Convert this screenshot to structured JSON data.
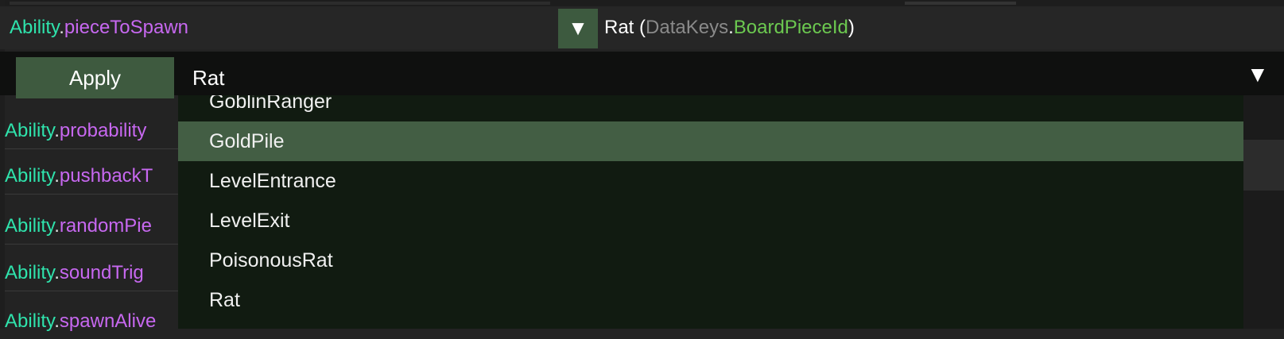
{
  "property_row": {
    "class_name": "Ability",
    "dot": ".",
    "field_name": "pieceToSpawn",
    "dropdown_toggle": "▼",
    "value": {
      "name": "Rat",
      "open_paren": " (",
      "namespace": "DataKeys",
      "dot": ".",
      "type": "BoardPieceId",
      "close_paren": ")"
    }
  },
  "editor_bar": {
    "apply_label": "Apply",
    "selected_value": "Rat",
    "arrow": "▼"
  },
  "background_rows": [
    {
      "class_name": "Ability",
      "dot": ".",
      "field_name": "probability"
    },
    {
      "class_name": "Ability",
      "dot": ".",
      "field_name": "pushbackT"
    },
    {
      "class_name": "Ability",
      "dot": ".",
      "field_name": "randomPie"
    },
    {
      "class_name": "Ability",
      "dot": ".",
      "field_name": "soundTrig"
    },
    {
      "class_name": "Ability",
      "dot": ".",
      "field_name": "spawnAlive"
    }
  ],
  "dropdown": {
    "items": [
      "GoblinRanger",
      "GoldPile",
      "LevelEntrance",
      "LevelExit",
      "PoisonousRat",
      "Rat"
    ],
    "highlighted": "GoldPile"
  },
  "colors": {
    "class": "#2fe3ac",
    "field": "#c768f0",
    "type": "#6cc950",
    "highlight": "#435e44",
    "dropdown_bg": "#111b11"
  }
}
